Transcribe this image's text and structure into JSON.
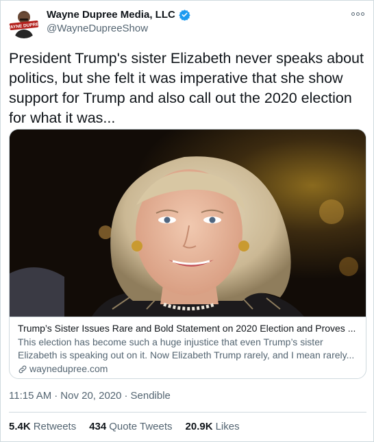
{
  "author": {
    "display_name": "Wayne Dupree Media, LLC",
    "handle": "@WayneDupreeShow",
    "avatar_text": "WAYNE DUPREE",
    "verified": true,
    "verified_icon": "verified-badge-icon"
  },
  "tweet": {
    "text": "President Trump's sister Elizabeth never speaks about politics, but she felt it was imperative that she show support for Trump and also call out the 2020 election for what it was..."
  },
  "card": {
    "title": "Trump’s Sister Issues Rare and Bold Statement on 2020 Election and Proves ...",
    "description": "This election has become such a huge injustice that even Trump’s sister Elizabeth is speaking out on it. Now Elizabeth Trump rarely, and I mean rarely...",
    "domain": "waynedupree.com",
    "domain_icon": "link-icon"
  },
  "meta": {
    "time": "11:15 AM",
    "separator": "·",
    "date": "Nov 20, 2020",
    "source": "Sendible"
  },
  "stats": {
    "retweets_count": "5.4K",
    "retweets_label": "Retweets",
    "quotes_count": "434",
    "quotes_label": "Quote Tweets",
    "likes_count": "20.9K",
    "likes_label": "Likes"
  },
  "colors": {
    "text_primary": "#0f1419",
    "text_secondary": "#536471",
    "border": "#cfd9de",
    "verified_blue": "#1d9bf0"
  }
}
